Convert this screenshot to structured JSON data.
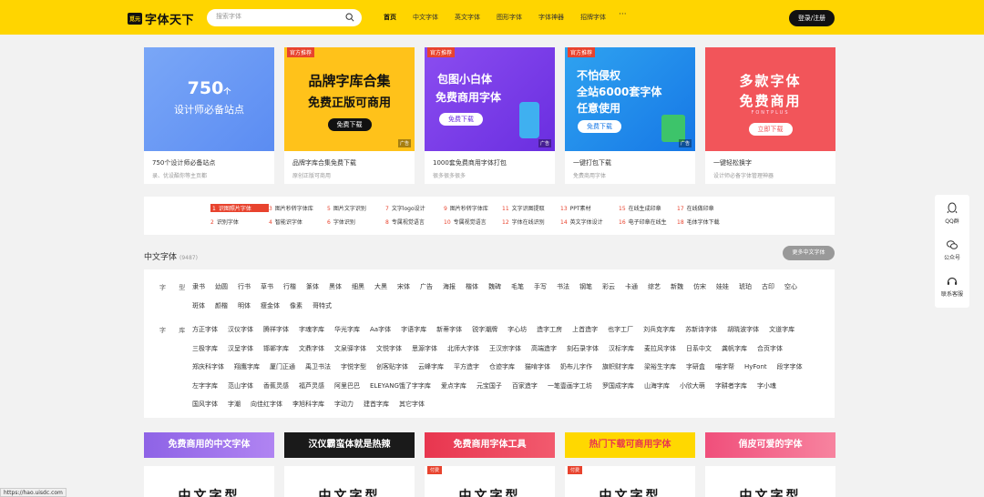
{
  "header": {
    "logo_badge": "觅元",
    "logo_text": "字体天下",
    "search_placeholder": "搜索字体",
    "nav": [
      "首页",
      "中文字体",
      "英文字体",
      "图形字体",
      "字体神器",
      "招牌字体"
    ],
    "nav_more": "···",
    "login": "登录/注册"
  },
  "banners": [
    {
      "big": "750",
      "unit": "个",
      "line2": "设计师必备站点",
      "title": "750个设计师必备站点",
      "sub": "录、优设酷你等主页都"
    },
    {
      "tag": "官方推荐",
      "line1": "品牌字库合集",
      "line2": "免费正版可商用",
      "btn": "免费下载",
      "ad": "广告",
      "title": "品牌字库合集免费下载",
      "sub": "原创正版可商用"
    },
    {
      "tag": "官方推荐",
      "line1": "包图小白体",
      "line2": "免费商用字体",
      "btn": "免费下载",
      "ad": "广告",
      "title": "1000套免费商用字体打包",
      "sub": "很多很多很多"
    },
    {
      "tag": "官方推荐",
      "line1": "不怕侵权",
      "line2": "全站6000套字体",
      "line3": "任意使用",
      "btn": "免费下载",
      "ad": "广告",
      "title": "一键打包下载",
      "sub": "免费商用字体"
    },
    {
      "line1": "多款字体",
      "line2": "免费商用",
      "line3": "FONTPLUS",
      "btn": "立即下载",
      "title": "一键轻松换字",
      "sub": "设计师必备字体管理神器"
    }
  ],
  "hot": {
    "row1": [
      {
        "n": "1",
        "t": "识图照片字体"
      },
      {
        "n": "3",
        "t": "图片秒转字体库"
      },
      {
        "n": "5",
        "t": "图片文字识别"
      },
      {
        "n": "7",
        "t": "文字logo设计"
      },
      {
        "n": "9",
        "t": "图片秒转字体库"
      },
      {
        "n": "11",
        "t": "文字识图提取"
      },
      {
        "n": "13",
        "t": "PPT素材"
      },
      {
        "n": "15",
        "t": "在线生成印章"
      },
      {
        "n": "17",
        "t": "在线做印章"
      }
    ],
    "row2": [
      {
        "n": "2",
        "t": "识别字体"
      },
      {
        "n": "4",
        "t": "智能识字体"
      },
      {
        "n": "6",
        "t": "字体识别"
      },
      {
        "n": "8",
        "t": "专属视觉语言"
      },
      {
        "n": "10",
        "t": "专属视觉语言"
      },
      {
        "n": "12",
        "t": "字体在线识别"
      },
      {
        "n": "14",
        "t": "英文字体设计"
      },
      {
        "n": "16",
        "t": "电子印章在线生"
      },
      {
        "n": "18",
        "t": "毛体字体下载"
      }
    ]
  },
  "section": {
    "title": "中文字体",
    "count": "(9487)",
    "more": "更多中文字体",
    "type_label": "字 型",
    "types": [
      "隶书",
      "幼圆",
      "行书",
      "草书",
      "行楷",
      "篆体",
      "黑体",
      "细黑",
      "大黑",
      "宋体",
      "广告",
      "海报",
      "楷体",
      "魏碑",
      "毛笔",
      "手写",
      "书法",
      "钢笔",
      "彩云",
      "卡通",
      "综艺",
      "新魏",
      "仿宋",
      "娃娃",
      "琥珀",
      "古印",
      "空心",
      "斑体",
      "颜楷",
      "明体",
      "瘦金体",
      "像素",
      "哥特式"
    ],
    "lib_label": "字 库",
    "libs": [
      "方正字体",
      "汉仪字体",
      "腾祥字体",
      "字魂字库",
      "华光字库",
      "Aa字体",
      "字语字库",
      "新蒂字体",
      "锐字潮牌",
      "字心坊",
      "造字工房",
      "上首造字",
      "也字工厂",
      "刘兵克字库",
      "苏新诗字体",
      "胡晓波字体",
      "文道字库",
      "三极字库",
      "汉呈字体",
      "邯郸字库",
      "文鼎字体",
      "文泉驿字体",
      "文悦字体",
      "思源字体",
      "北师大字体",
      "王汉宗字体",
      "高端造字",
      "刻石录字体",
      "汉标字库",
      "麦拉风字体",
      "日系中文",
      "龚帆字库",
      "合页字体",
      "郑庆科字体",
      "翔鹰字库",
      "厦门正通",
      "禹卫书法",
      "字悦字型",
      "创客贴字体",
      "云峰字库",
      "平方造字",
      "仓迹字库",
      "猫啃字体",
      "奶布儿字作",
      "旗帜财字库",
      "梁裕生字库",
      "字研盒",
      "喵字帮",
      "HyFont",
      "段字字体",
      "左字字库",
      "范山字体",
      "香蕉灵感",
      "福芦灵感",
      "阿里巴巴",
      "ELEYANG饿了字字库",
      "爱点字库",
      "元宝国子",
      "百家造字",
      "一笔壹画字工坊",
      "罗国成字库",
      "山海字库",
      "小欣大萌",
      "字耕者字库",
      "字小魂",
      "国风字体",
      "字潮",
      "向佳红字体",
      "李旭科字库",
      "字动力",
      "建首字库",
      "其它字体"
    ]
  },
  "ribbons": [
    "免费商用的中文字体",
    "汉仪霸蛮体就是热辣",
    "免费商用字体工具",
    "热门下载可商用字体",
    "俏皮可爱的字体"
  ],
  "thumbs": [
    {
      "sample": "中文字型"
    },
    {
      "sample": "中文字型"
    },
    {
      "tag": "付费",
      "sample": "中文字型"
    },
    {
      "tag": "付费",
      "sample": "中文字型"
    },
    {
      "sample": "中文字型"
    }
  ],
  "float": [
    "QQ群",
    "公众号",
    "联系客服"
  ],
  "status": "https://hao.uisdc.com"
}
